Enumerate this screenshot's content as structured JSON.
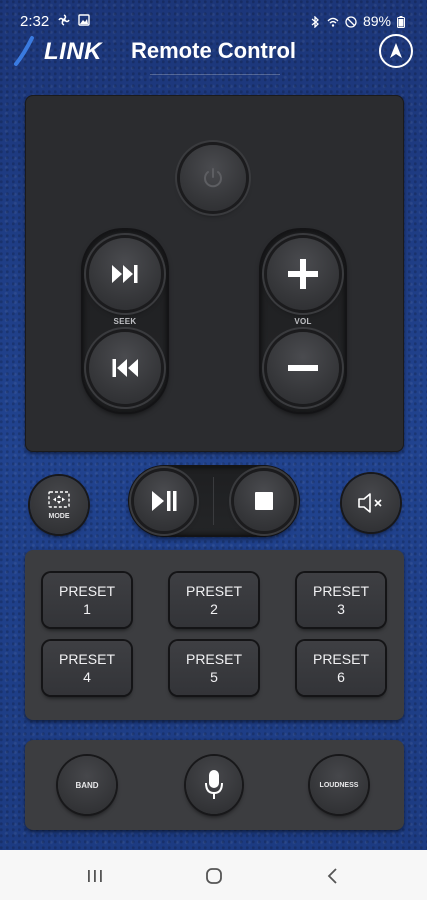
{
  "status_bar": {
    "time": "2:32",
    "battery": "89%"
  },
  "header": {
    "logo_text": "LINK",
    "title": "Remote Control"
  },
  "seek": {
    "label": "SEEK"
  },
  "volume": {
    "label": "VOL"
  },
  "controls": {
    "mode_label": "MODE"
  },
  "presets": [
    {
      "label": "PRESET",
      "number": "1"
    },
    {
      "label": "PRESET",
      "number": "2"
    },
    {
      "label": "PRESET",
      "number": "3"
    },
    {
      "label": "PRESET",
      "number": "4"
    },
    {
      "label": "PRESET",
      "number": "5"
    },
    {
      "label": "PRESET",
      "number": "6"
    }
  ],
  "bottom": {
    "band_label": "BAND",
    "loudness_label": "LOUDNESS"
  },
  "colors": {
    "background": "#1f3d86",
    "panel": "#2b2c2f",
    "button": "#3e3f43"
  }
}
